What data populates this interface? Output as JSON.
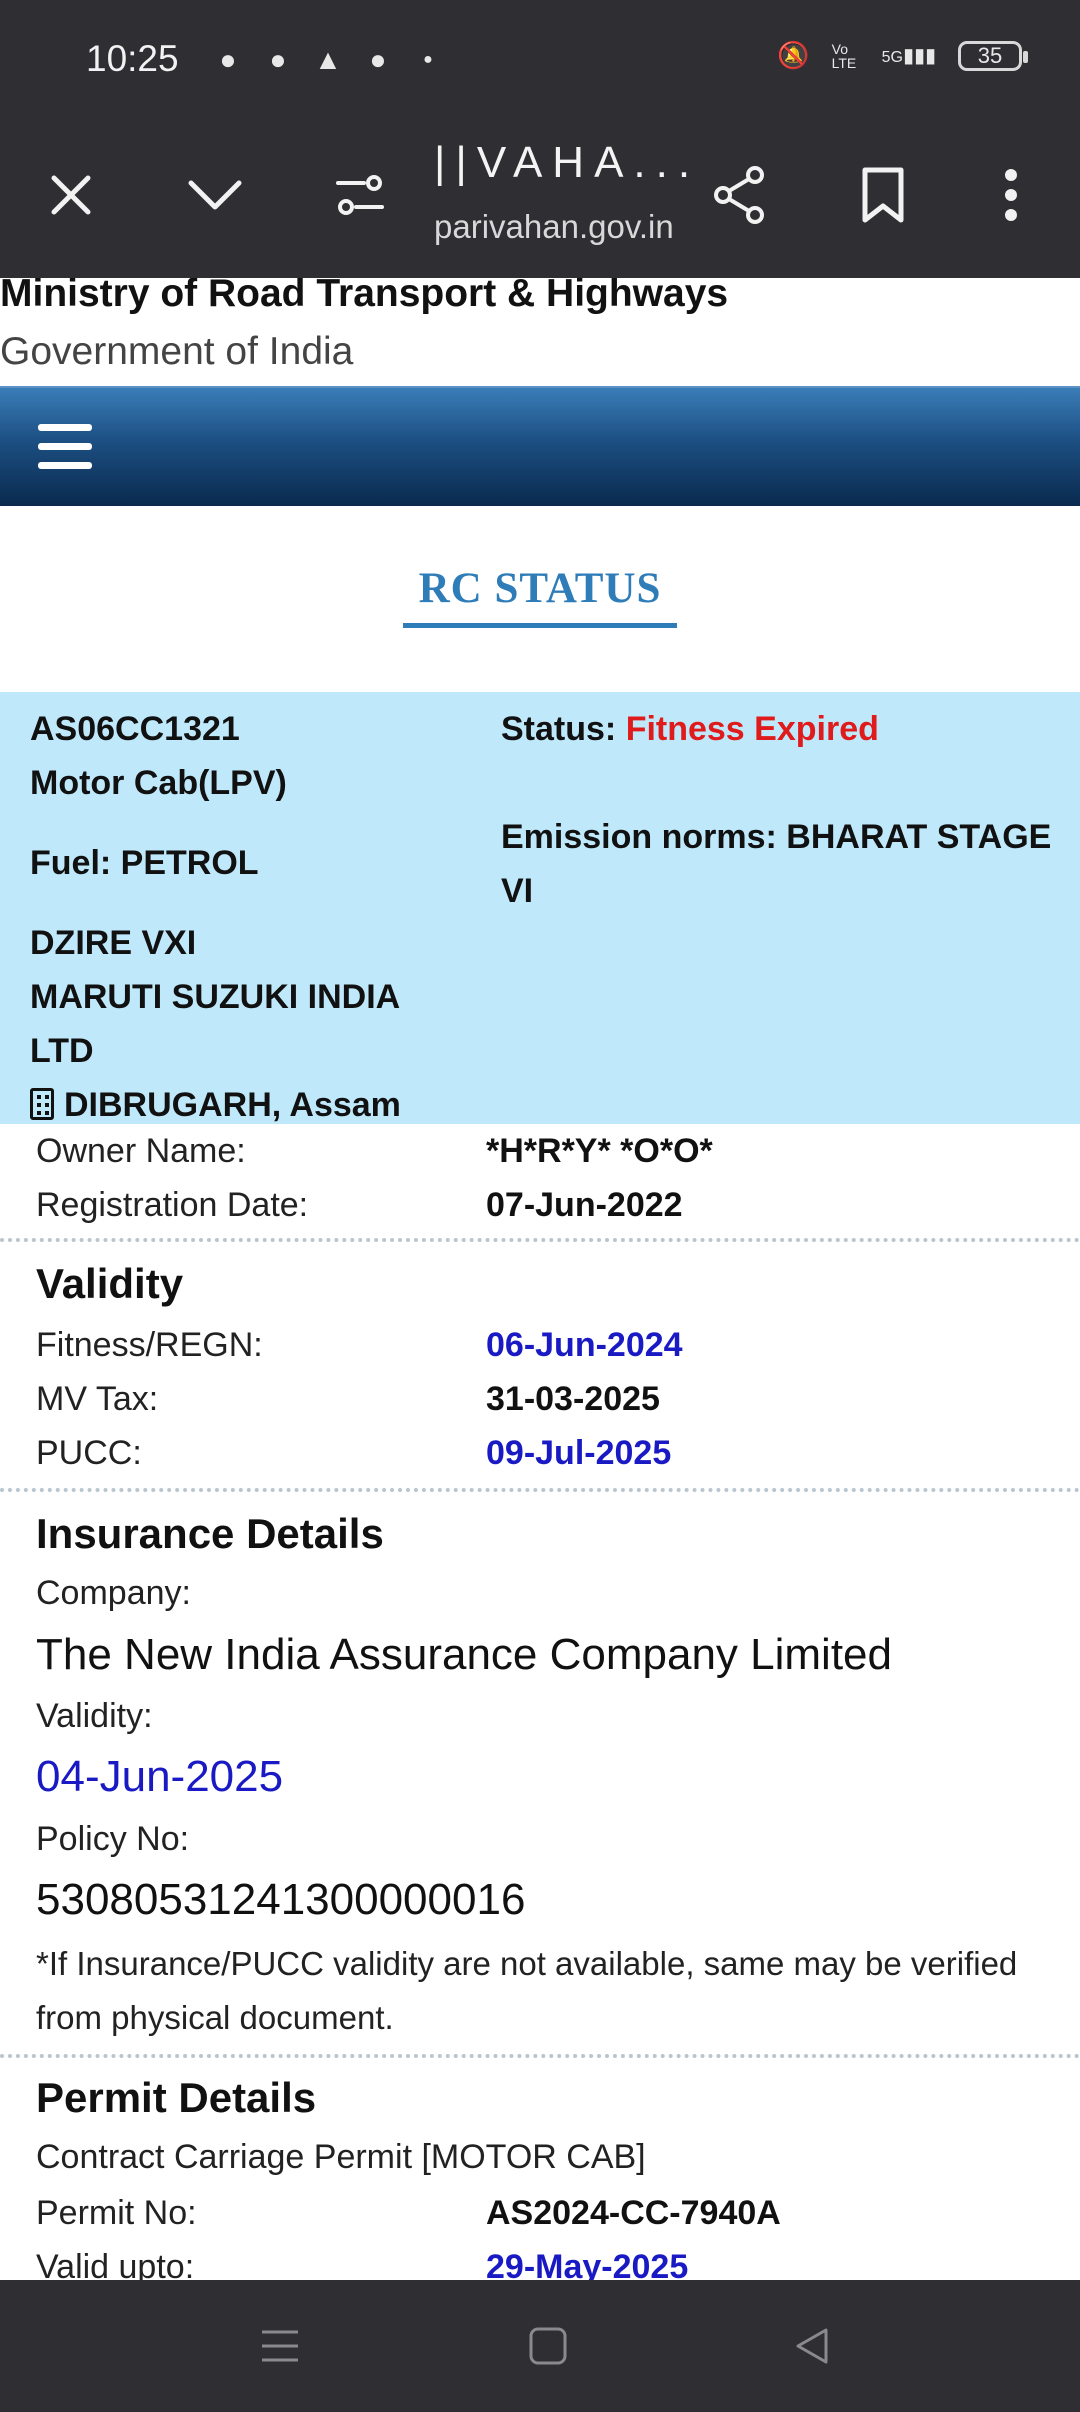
{
  "status_bar": {
    "time": "10:25",
    "battery": "35",
    "network_label": "5G",
    "volte_label": "Vo LTE"
  },
  "browser": {
    "title": "||VAHA...",
    "url": "parivahan.gov.in"
  },
  "header": {
    "ministry": "Ministry of Road Transport & Highways",
    "government": "Government of India"
  },
  "page_title": "RC STATUS",
  "vehicle": {
    "reg_no": "AS06CC1321",
    "vehicle_class": "Motor Cab(LPV)",
    "fuel": "Fuel: PETROL",
    "model": "DZIRE VXI",
    "maker_line1": "MARUTI SUZUKI INDIA",
    "maker_line2": "LTD",
    "location": "DIBRUGARH, Assam",
    "status_label": "Status:",
    "status_value": "Fitness Expired",
    "emission_line1": "Emission norms: BHARAT STAGE",
    "emission_line2": "VI"
  },
  "owner": {
    "owner_label": "Owner Name:",
    "owner_value": "*H*R*Y* *O*O*",
    "reg_date_label": "Registration Date:",
    "reg_date_value": "07-Jun-2022"
  },
  "validity": {
    "title": "Validity",
    "fitness_label": "Fitness/REGN:",
    "fitness_value": "06-Jun-2024",
    "tax_label": "MV Tax:",
    "tax_value": "31-03-2025",
    "pucc_label": "PUCC:",
    "pucc_value": "09-Jul-2025"
  },
  "insurance": {
    "title": "Insurance Details",
    "company_label": "Company:",
    "company_value": "The New India Assurance Company Limited",
    "validity_label": "Validity:",
    "validity_value": "04-Jun-2025",
    "policy_label": "Policy No:",
    "policy_value": "53080531241300000016",
    "note": "*If Insurance/PUCC validity are not available, same may be verified from physical document."
  },
  "permit": {
    "title": "Permit Details",
    "type": "Contract Carriage Permit [MOTOR CAB]",
    "permit_no_label": "Permit No:",
    "permit_no_value": "AS2024-CC-7940A",
    "valid_label": "Valid upto:",
    "valid_value": "29-May-2025"
  },
  "icons": {
    "close": "close-icon",
    "collapse": "chevron-down-icon",
    "site_settings": "tune-icon",
    "share": "share-icon",
    "bookmark": "bookmark-icon",
    "more": "more-vert-icon",
    "menu": "hamburger-icon",
    "location": "building-icon"
  }
}
